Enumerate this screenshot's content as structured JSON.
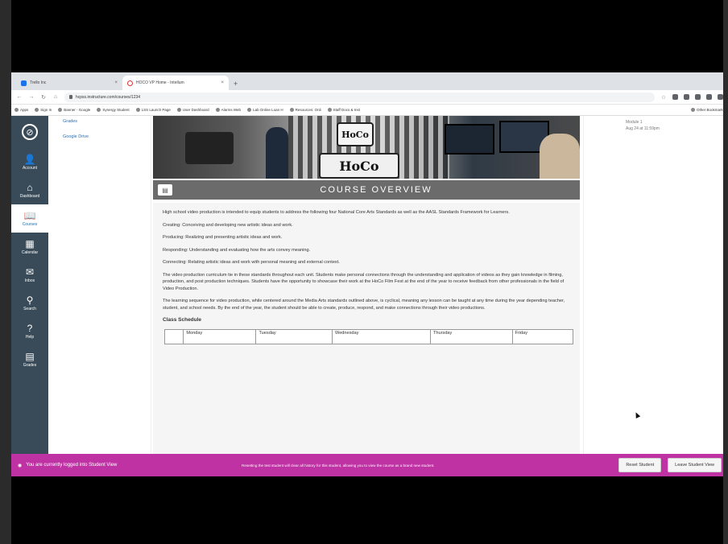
{
  "browser": {
    "tabs": [
      {
        "label": "Trello Inc"
      },
      {
        "label": "HOCO VP Home - Intellum"
      }
    ],
    "new_tab": "+",
    "url": "hcpss.instructure.com/courses/1234",
    "bookmarks": [
      "Apps",
      "Sign In",
      "Banner - Google",
      "Synergy Student",
      "LSS Launch Page",
      "User Dashboard",
      "Alarms Web",
      "Lab Online Loan H",
      "Resources: Onli",
      "Staff Docs & Inst"
    ],
    "other_bookmarks": "Other Bookmarks"
  },
  "global_nav": {
    "items": [
      {
        "label": "Account",
        "icon": "account-icon",
        "glyph": "👤"
      },
      {
        "label": "Dashboard",
        "icon": "dashboard-icon",
        "glyph": "⌂"
      },
      {
        "label": "Courses",
        "icon": "courses-icon",
        "glyph": "📖"
      },
      {
        "label": "Calendar",
        "icon": "calendar-icon",
        "glyph": "▦"
      },
      {
        "label": "Inbox",
        "icon": "inbox-icon",
        "glyph": "✉"
      },
      {
        "label": "Search",
        "icon": "search-icon",
        "glyph": "⚲"
      },
      {
        "label": "Help",
        "icon": "help-icon",
        "glyph": "?"
      },
      {
        "label": "Grades",
        "icon": "grades-icon",
        "glyph": "▤"
      }
    ]
  },
  "course_nav": {
    "items": [
      "Grades",
      "Google Drive"
    ]
  },
  "page": {
    "heading": "COURSE OVERVIEW",
    "intro": "High school video production is intended to equip students to address the following four National Core Arts Standards as well as the AASL Standards Framework for Learners.",
    "creating": "Creating: Conceiving and developing new artistic ideas and work.",
    "producing": "Producing: Realizing and presenting artistic ideas and work.",
    "responding": "Responding: Understanding and evaluating how the arts convey meaning.",
    "connecting": "Connecting: Relating artistic ideas and work with personal meaning and external context.",
    "paragraph2": "The video production curriculum tie in these standards throughout each unit. Students make personal connections through the understanding and application of videos as they gain knowledge in filming, production, and post production techniques. Students have the opportunity to showcase their work at the HoCo Film Fest at the end of the year to receive feedback from other professionals in the field of Video Production.",
    "paragraph3": "The learning sequence for video production, while centered around the Media Arts standards outlined above, is cyclical, meaning any lesson can be taught at any time during the year depending teacher, student, and school needs. By the end of the year, the student should be able to create, produce, respond, and make connections through their video productions.",
    "schedule_title": "Class Schedule",
    "schedule_headers": [
      "",
      "Monday",
      "Tuesday",
      "Wednesday",
      "Thursday",
      "Friday"
    ]
  },
  "banner": {
    "logo_top": "HoCo",
    "logo_bottom": "HoCo"
  },
  "right_side": {
    "line1": "Module 1",
    "line2": "Aug 24 at 11:59pm"
  },
  "student_view": {
    "status": "You are currently logged into Student View",
    "note": "Resetting the test student will clear all history for this student, allowing you to view the course as a brand new student.",
    "reset_button": "Reset Student",
    "leave_button": "Leave Student View"
  },
  "colors": {
    "nav_bg": "#394b58",
    "student_bar": "#bf32a4",
    "heading_bar": "#6b6b6b",
    "link": "#2d6fb0"
  }
}
